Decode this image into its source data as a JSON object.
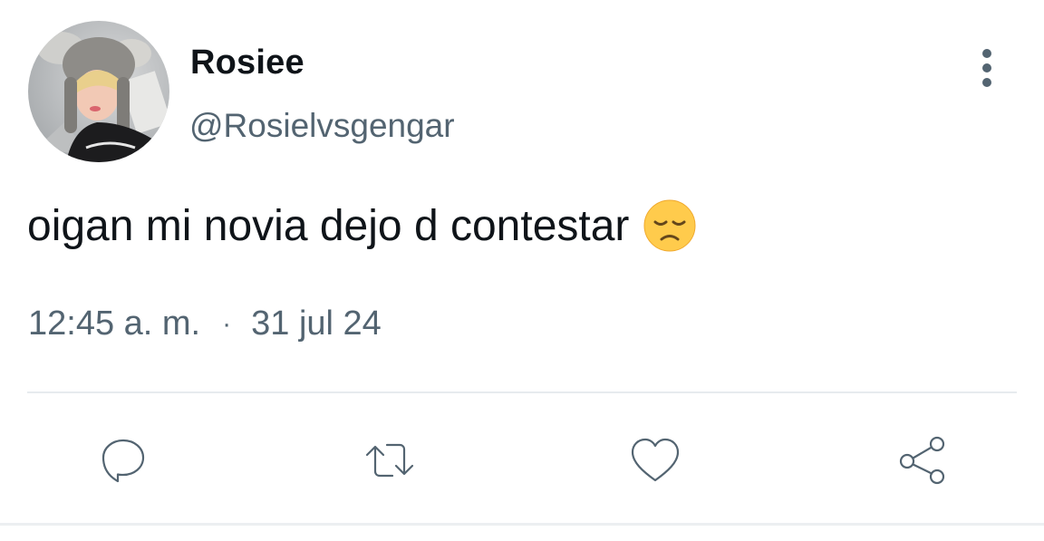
{
  "tweet": {
    "author": {
      "display_name": "Rosiee",
      "handle": "@Rosielvsgengar"
    },
    "text": "oigan mi novia dejo d contestar",
    "emoji": "disappointed-face-emoji",
    "time": "12:45 a. m.",
    "separator": "·",
    "date": "31 jul 24"
  },
  "icons": {
    "more": "more-vertical-icon",
    "reply": "reply-icon",
    "retweet": "retweet-icon",
    "like": "heart-icon",
    "share": "share-icon"
  },
  "colors": {
    "text_primary": "#0f1419",
    "text_secondary": "#536471",
    "divider": "#e7ebee",
    "emoji_face": "#ffcb4c"
  }
}
